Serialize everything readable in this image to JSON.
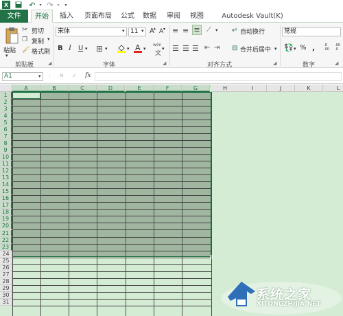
{
  "quick_access": {
    "excel_icon": "excel-icon",
    "save_icon": "save-icon",
    "undo_icon": "undo-icon",
    "redo_icon": "redo-icon",
    "customize_icon": "dropdown-icon"
  },
  "tabs": [
    {
      "label": "文件"
    },
    {
      "label": "开始"
    },
    {
      "label": "插入"
    },
    {
      "label": "页面布局"
    },
    {
      "label": "公式"
    },
    {
      "label": "数据"
    },
    {
      "label": "审阅"
    },
    {
      "label": "视图"
    },
    {
      "label": "Autodesk Vault(K)"
    }
  ],
  "ribbon": {
    "clipboard": {
      "paste": "粘贴",
      "cut": "剪切",
      "copy": "复制",
      "format_painter": "格式刷",
      "label": "剪贴板"
    },
    "font": {
      "name": "宋体",
      "size": "11",
      "grow": "A",
      "shrink": "A",
      "bold": "B",
      "italic": "I",
      "underline": "U",
      "wen": "wén",
      "label": "字体"
    },
    "alignment": {
      "wrap_text": "自动换行",
      "merge_center": "合并后居中",
      "label": "对齐方式"
    },
    "number": {
      "format": "常规",
      "percent": "%",
      "comma": ",",
      "inc_decimal": ".0 .00",
      "dec_decimal": ".00 .0",
      "label": "数字"
    }
  },
  "formula_bar": {
    "name_box": "A1",
    "cancel": "✕",
    "enter": "✓",
    "fx": "fx"
  },
  "sheet": {
    "columns": [
      "A",
      "B",
      "C",
      "D",
      "E",
      "F",
      "G",
      "H",
      "I",
      "J",
      "K",
      "L"
    ],
    "rows": [
      "1",
      "2",
      "3",
      "4",
      "5",
      "6",
      "7",
      "8",
      "9",
      "10",
      "11",
      "12",
      "13",
      "14",
      "15",
      "16",
      "17",
      "18",
      "19",
      "20",
      "21",
      "22",
      "23",
      "24",
      "25",
      "26",
      "27",
      "28",
      "29",
      "30",
      "31"
    ],
    "selected_range": "A1:G23"
  },
  "watermark": {
    "text": "系统之家",
    "url": "XITONGZHIJIA.NET"
  },
  "colors": {
    "accent": "#217346",
    "selection": "#a1b6a1",
    "sheet_bg": "#d4ebd4"
  }
}
